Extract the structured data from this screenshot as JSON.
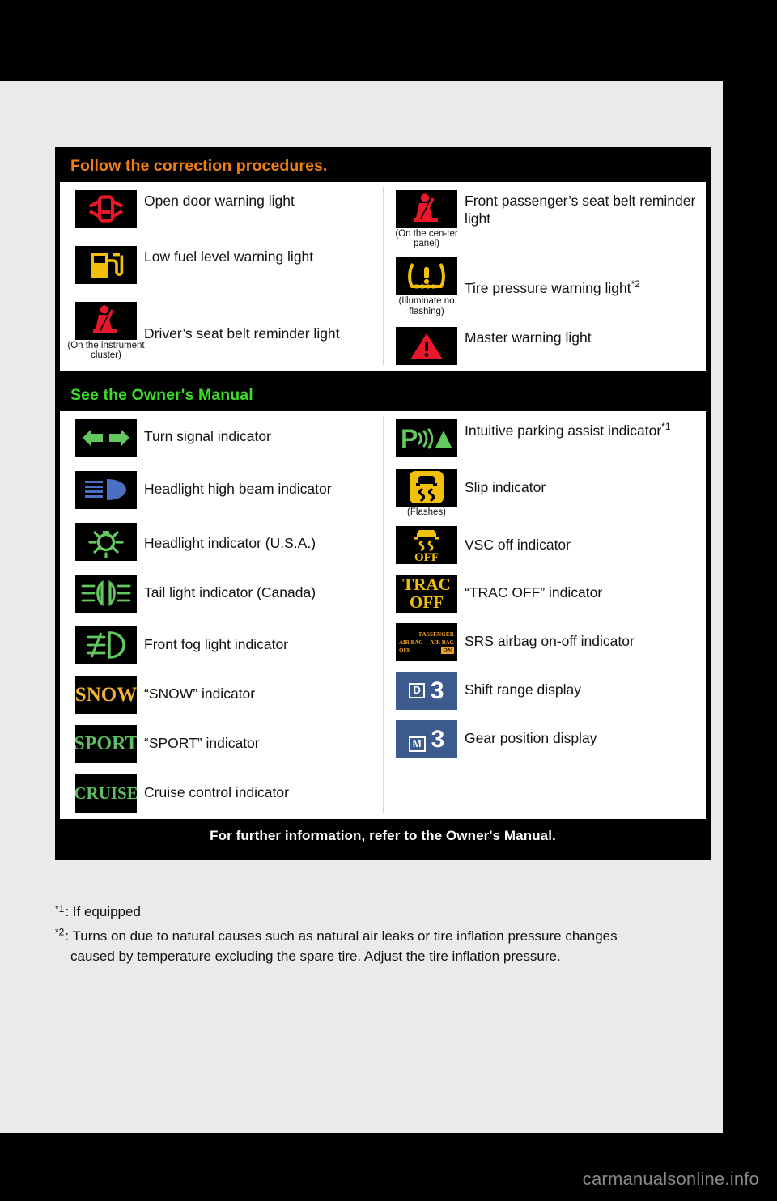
{
  "sections": [
    {
      "id": "correction",
      "title": "Follow the correction procedures.",
      "title_color": "#f07f10",
      "left_items": [
        {
          "icon": "open-door-warning-icon",
          "label": "Open door warning light",
          "note": ""
        },
        {
          "icon": "low-fuel-warning-icon",
          "label": "Low fuel level warning light",
          "note": ""
        },
        {
          "icon": "driver-seat-belt-reminder-icon",
          "label": "Driver’s seat belt reminder light",
          "note": "(On the instrument cluster)"
        }
      ],
      "right_items": [
        {
          "icon": "passenger-seat-belt-reminder-icon",
          "label": "Front passenger’s seat belt reminder light",
          "note": "(On the cen-ter panel)"
        },
        {
          "icon": "tire-pressure-warning-icon",
          "label": "Tire pressure warning light",
          "sup": "*2",
          "note": "(Illuminate no flashing)"
        },
        {
          "icon": "master-warning-icon",
          "label": "Master warning light",
          "note": ""
        }
      ]
    },
    {
      "id": "owners-manual",
      "title": "See the Owner's Manual",
      "title_color": "#3ddc28",
      "left_items": [
        {
          "icon": "turn-signal-icon",
          "label": "Turn signal indicator",
          "note": ""
        },
        {
          "icon": "high-beam-icon",
          "label": "Headlight high beam indicator",
          "note": ""
        },
        {
          "icon": "headlight-icon",
          "label": "Headlight indicator (U.S.A.)",
          "note": ""
        },
        {
          "icon": "tail-light-icon",
          "label": "Tail light indicator (Canada)",
          "note": ""
        },
        {
          "icon": "front-fog-light-icon",
          "label": "Front fog light indicator",
          "note": ""
        },
        {
          "icon": "snow-indicator-icon",
          "label": "“SNOW” indicator",
          "note": "",
          "tile_text": "SNOW",
          "tile_color": "#f2b233"
        },
        {
          "icon": "sport-indicator-icon",
          "label": "“SPORT” indicator",
          "note": "",
          "tile_text": "SPORT",
          "tile_color": "#5fbf62"
        },
        {
          "icon": "cruise-control-icon",
          "label": "Cruise control indicator",
          "note": "",
          "tile_text": "CRUISE",
          "tile_color": "#5fbf62"
        }
      ],
      "right_items": [
        {
          "icon": "intuitive-parking-assist-icon",
          "label": "Intuitive parking assist indicator",
          "sup": "*1",
          "note": ""
        },
        {
          "icon": "slip-indicator-icon",
          "label": "Slip indicator",
          "note": "(Flashes)"
        },
        {
          "icon": "vsc-off-icon",
          "label": "VSC off indicator",
          "note": ""
        },
        {
          "icon": "trac-off-icon",
          "label": "“TRAC OFF” indicator",
          "note": "",
          "tile_text_1": "TRAC",
          "tile_text_2": "OFF"
        },
        {
          "icon": "srs-airbag-on-off-icon",
          "label": "SRS airbag on-off indicator",
          "note": "",
          "airbag": {
            "passenger": "PASSENGER",
            "left": "AIR BAG",
            "right": "AIR BAG",
            "off": "OFF",
            "on": "ON"
          }
        },
        {
          "icon": "shift-range-display-icon",
          "label": "Shift range display",
          "note": "",
          "shift_letter": "D",
          "shift_number": "3"
        },
        {
          "icon": "gear-position-display-icon",
          "label": "Gear position display",
          "note": "",
          "shift_letter": "M",
          "shift_number": "3"
        }
      ]
    }
  ],
  "footer_banner": "For further information, refer to the Owner's Manual.",
  "footnotes": [
    {
      "marker": "*1",
      "text": ": If equipped",
      "cont": ""
    },
    {
      "marker": "*2",
      "text": ": Turns on due to natural causes such as natural air leaks or tire inflation pressure changes",
      "cont": "caused by temperature excluding the spare tire. Adjust the tire inflation pressure."
    }
  ],
  "watermark": "carmanualsonline.info",
  "colors": {
    "orange": "#f07f10",
    "green": "#3ddc28",
    "red": "#e8172a",
    "yellow": "#f2c009",
    "blue_tile": "#3c5a8c",
    "page_bg": "#eaeaea"
  }
}
